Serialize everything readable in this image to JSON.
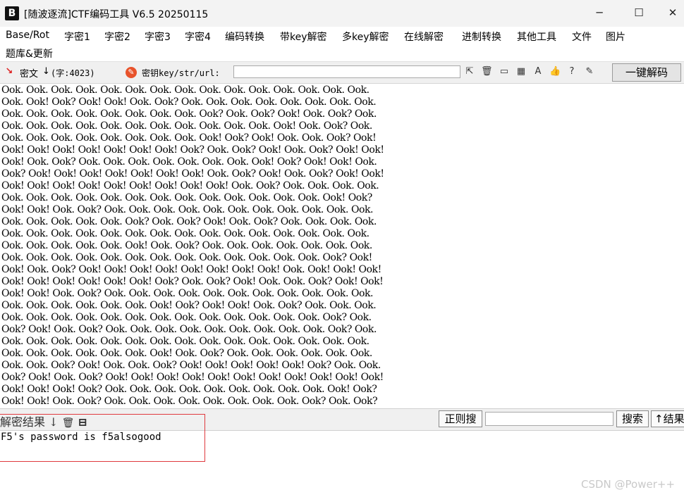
{
  "window": {
    "logo": "B",
    "title": "[随波逐流]CTF编码工具 V6.5 20250115",
    "controls": {
      "minimize": "─",
      "maximize": "☐",
      "close": "✕"
    }
  },
  "menu": [
    "Base/Rot",
    "字密1",
    "字密2",
    "字密3",
    "字密4",
    "编码转换",
    "带key解密",
    "多key解密",
    "在线解密",
    "进制转换",
    "其他工具",
    "文件",
    "图片",
    "题库&更新"
  ],
  "toolbar": {
    "cipher_label": "密文",
    "char_count": "(字:4023)",
    "key_label": "密钥key/str/url:",
    "key_value": "",
    "decode_button": "一键解码"
  },
  "cipher_lines": [
    "Ook. Ook. Ook. Ook. Ook. Ook. Ook. Ook. Ook. Ook. Ook. Ook. Ook. Ook. Ook.",
    "Ook. Ook! Ook? Ook! Ook! Ook. Ook? Ook. Ook. Ook. Ook. Ook. Ook. Ook. Ook.",
    "Ook. Ook. Ook. Ook. Ook. Ook. Ook. Ook. Ook? Ook. Ook? Ook! Ook. Ook? Ook.",
    "Ook. Ook. Ook. Ook. Ook. Ook. Ook. Ook. Ook. Ook. Ook. Ook! Ook. Ook? Ook.",
    "Ook. Ook. Ook. Ook. Ook. Ook. Ook. Ook. Ook! Ook? Ook! Ook. Ook. Ook? Ook!",
    "Ook! Ook! Ook! Ook! Ook! Ook! Ook! Ook? Ook. Ook? Ook! Ook. Ook? Ook! Ook!",
    "Ook! Ook. Ook? Ook. Ook. Ook. Ook. Ook. Ook. Ook. Ook! Ook? Ook! Ook! Ook.",
    "Ook? Ook! Ook! Ook! Ook! Ook! Ook! Ook! Ook. Ook? Ook! Ook. Ook? Ook! Ook!",
    "Ook! Ook! Ook! Ook! Ook! Ook! Ook! Ook! Ook! Ook. Ook? Ook. Ook. Ook. Ook.",
    "Ook. Ook. Ook. Ook. Ook. Ook. Ook. Ook. Ook. Ook. Ook. Ook. Ook. Ook! Ook?",
    "Ook! Ook! Ook. Ook? Ook. Ook. Ook. Ook. Ook. Ook. Ook. Ook. Ook. Ook. Ook.",
    "Ook. Ook. Ook. Ook. Ook. Ook? Ook. Ook? Ook! Ook. Ook? Ook. Ook. Ook. Ook.",
    "Ook. Ook. Ook. Ook. Ook. Ook. Ook. Ook. Ook. Ook. Ook. Ook. Ook. Ook. Ook.",
    "Ook. Ook. Ook. Ook. Ook. Ook! Ook. Ook? Ook. Ook. Ook. Ook. Ook. Ook. Ook.",
    "Ook. Ook. Ook. Ook. Ook. Ook. Ook. Ook. Ook. Ook. Ook. Ook. Ook. Ook? Ook!",
    "Ook! Ook. Ook? Ook! Ook! Ook! Ook! Ook! Ook! Ook! Ook! Ook. Ook! Ook! Ook!",
    "Ook! Ook! Ook! Ook! Ook! Ook! Ook? Ook. Ook? Ook! Ook. Ook. Ook? Ook! Ook!",
    "Ook! Ook! Ook. Ook? Ook. Ook. Ook. Ook. Ook. Ook. Ook. Ook. Ook. Ook. Ook.",
    "Ook. Ook. Ook. Ook. Ook. Ook. Ook! Ook? Ook! Ook! Ook. Ook? Ook. Ook. Ook.",
    "Ook. Ook. Ook. Ook. Ook. Ook. Ook. Ook. Ook. Ook. Ook. Ook. Ook. Ook? Ook.",
    "Ook? Ook! Ook. Ook? Ook. Ook. Ook. Ook. Ook. Ook. Ook. Ook. Ook. Ook? Ook.",
    "Ook. Ook. Ook. Ook. Ook. Ook. Ook. Ook. Ook. Ook. Ook. Ook. Ook. Ook. Ook.",
    "Ook. Ook. Ook. Ook. Ook. Ook. Ook! Ook. Ook? Ook. Ook. Ook. Ook. Ook. Ook.",
    "Ook. Ook. Ook? Ook! Ook. Ook. Ook? Ook! Ook! Ook! Ook! Ook! Ook? Ook. Ook.",
    "Ook? Ook! Ook. Ook? Ook! Ook! Ook! Ook! Ook! Ook! Ook! Ook! Ook! Ook! Ook!",
    "Ook! Ook! Ook! Ook? Ook. Ook. Ook. Ook. Ook. Ook. Ook. Ook. Ook. Ook! Ook?",
    "Ook! Ook! Ook. Ook? Ook. Ook. Ook. Ook. Ook. Ook. Ook. Ook. Ook? Ook. Ook?"
  ],
  "result": {
    "label": "解密结果",
    "regex_button": "正则搜",
    "search_value": "",
    "search_button": "搜索",
    "result_up_button": "结果",
    "text": "F5's password is f5alsogood"
  },
  "watermark": "CSDN @Power++",
  "colors": {
    "highlight_border": "#e0393e",
    "toolbar_bg": "#f0f0f0"
  },
  "icons": {
    "cipher": "cipher-icon",
    "key": "key-icon",
    "select": "cursor-select-icon",
    "delete": "trash-icon",
    "terminal": "terminal-icon",
    "calculator": "calculator-icon",
    "font": "font-icon",
    "like": "thumbs-up-icon",
    "help": "help-icon",
    "edit": "edit-icon"
  }
}
